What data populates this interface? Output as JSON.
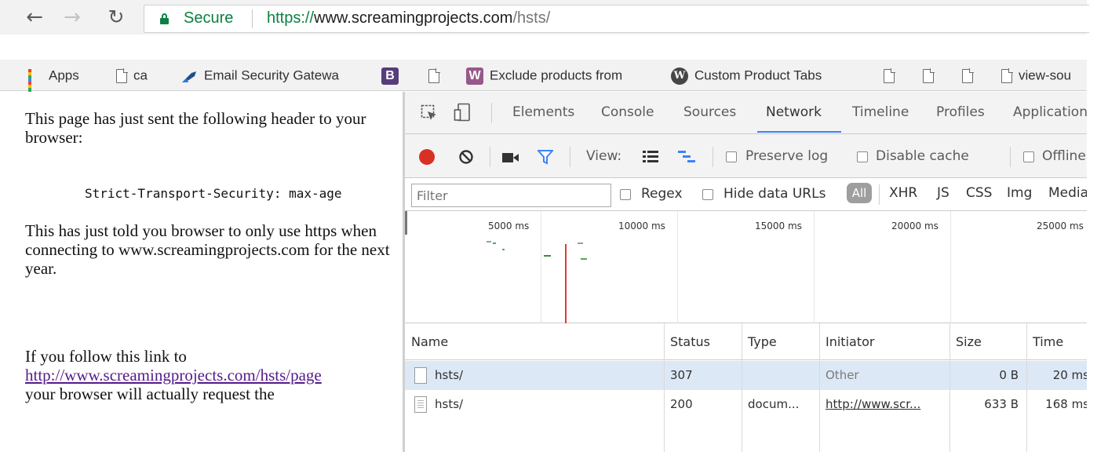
{
  "browser": {
    "security_label": "Secure",
    "url": {
      "scheme": "https://",
      "host": "www.screamingprojects.com",
      "path": "/hsts/"
    },
    "bookmarks": [
      {
        "label": "Apps",
        "icon": "apps-grid-icon"
      },
      {
        "label": "ca",
        "icon": "page-icon"
      },
      {
        "label": "Email Security Gatewa",
        "icon": "email-gateway-icon"
      },
      {
        "label": "",
        "icon": "bootstrap-b-icon",
        "glyph": "B"
      },
      {
        "label": "",
        "icon": "page-icon"
      },
      {
        "label": "Exclude products from",
        "icon": "woocommerce-w-icon",
        "glyph": "W"
      },
      {
        "label": "Custom Product Tabs",
        "icon": "wordpress-icon"
      },
      {
        "label": "",
        "icon": "page-icon"
      },
      {
        "label": "",
        "icon": "page-icon"
      },
      {
        "label": "",
        "icon": "page-icon"
      },
      {
        "label": "view-sou",
        "icon": "page-icon"
      }
    ]
  },
  "page": {
    "para1": "This page has just sent the following header to your browser:",
    "code_line": "Strict-Transport-Security: max-age",
    "para2": "This has just told you browser to only use https when connecting to www.screamingprojects.com for the next year.",
    "para3_prefix": "If you follow this link to",
    "para3_link": "http://www.screamingprojects.com/hsts/page",
    "para3_suffix": "your browser will actually request the"
  },
  "devtools": {
    "tabs": [
      "Elements",
      "Console",
      "Sources",
      "Network",
      "Timeline",
      "Profiles",
      "Application"
    ],
    "active_tab": "Network",
    "toolbar": {
      "view_label": "View:",
      "preserve_log": "Preserve log",
      "disable_cache": "Disable cache",
      "offline": "Offline"
    },
    "filter": {
      "placeholder": "Filter",
      "regex": "Regex",
      "hide_data_urls": "Hide data URLs",
      "all": "All",
      "types": [
        "XHR",
        "JS",
        "CSS",
        "Img",
        "Media"
      ]
    },
    "timeline_ticks": [
      "5000 ms",
      "10000 ms",
      "15000 ms",
      "20000 ms",
      "25000 ms"
    ],
    "columns": [
      "Name",
      "Status",
      "Type",
      "Initiator",
      "Size",
      "Time"
    ],
    "rows": [
      {
        "name": "hsts/",
        "status": "307",
        "type": "",
        "initiator": "Other",
        "size": "0 B",
        "time": "20 ms"
      },
      {
        "name": "hsts/",
        "status": "200",
        "type": "docum...",
        "initiator": "http://www.scr...",
        "size": "633 B",
        "time": "168 ms"
      }
    ],
    "colors": {
      "accent": "#3e82f7",
      "record": "#d93025",
      "selected_row": "#dce8f6"
    }
  }
}
